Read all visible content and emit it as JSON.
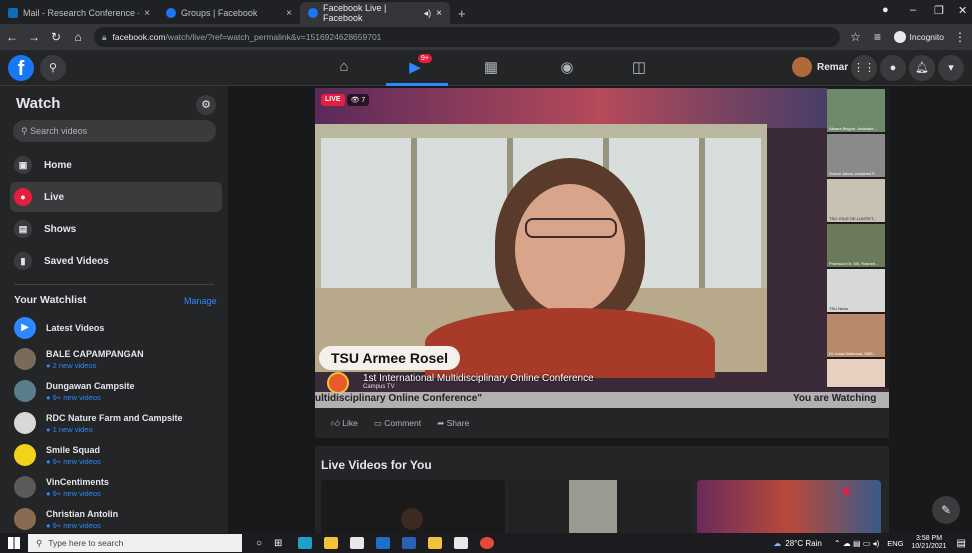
{
  "browser": {
    "tabs": [
      {
        "label": "Mail - Research Conference - O",
        "color": "#0f6cbd"
      },
      {
        "label": "Groups | Facebook",
        "color": "#1877f2"
      },
      {
        "label": "Facebook Live | Facebook",
        "color": "#1877f2"
      }
    ],
    "url_host": "facebook.com",
    "url_path": "/watch/live/?ref=watch_permalink&v=1516924628659701",
    "incognito_label": "Incognito"
  },
  "fb_header": {
    "badge": "9+",
    "user_name": "Remar"
  },
  "sidebar": {
    "title": "Watch",
    "search_placeholder": "Search videos",
    "nav": [
      {
        "label": "Home"
      },
      {
        "label": "Live"
      },
      {
        "label": "Shows"
      },
      {
        "label": "Saved Videos"
      }
    ],
    "watchlist_title": "Your Watchlist",
    "manage_label": "Manage",
    "watchlist": [
      {
        "name": "Latest Videos",
        "sub": "",
        "color": "#2d88ff"
      },
      {
        "name": "BALE CAPAMPANGAN",
        "sub": "2 new videos",
        "color": "#7a6a5a"
      },
      {
        "name": "Dungawan Campsite",
        "sub": "9+ new videos",
        "color": "#5b7f8a"
      },
      {
        "name": "RDC Nature Farm and Campsite",
        "sub": "1 new video",
        "color": "#d8d8d8"
      },
      {
        "name": "Smile Squad",
        "sub": "9+ new videos",
        "color": "#f2d21b"
      },
      {
        "name": "VinCentiments",
        "sub": "9+ new videos",
        "color": "#5a5a5a"
      },
      {
        "name": "Christian Antolin",
        "sub": "9+ new videos",
        "color": "#8a6a50"
      }
    ]
  },
  "video": {
    "live_label": "LIVE",
    "viewers": "7",
    "name_tag": "TSU Armee Rosel",
    "caption_line1": "1st International Multidisciplinary Online Conference",
    "caption_small": "Campus TV",
    "ticker_left": "ultidisciplinary Online Conference\"",
    "ticker_right": "You are Watching",
    "participants": [
      "Afsana Begum, Assistant...",
      "Nusrat Jahan, Assistant P...",
      "TSU: EILIE DE LUNTIET...",
      "Professor Dr. Md. Rashed...",
      "TSU News",
      "Dr. Imran Mahmud, SME...",
      ""
    ]
  },
  "actions": {
    "like": "Like",
    "comment": "Comment",
    "share": "Share"
  },
  "live_videos_title": "Live Videos for You",
  "taskbar": {
    "search_placeholder": "Type here to search",
    "weather": "28°C  Rain",
    "lang": "ENG",
    "time": "3:58 PM",
    "date": "10/21/2021"
  }
}
